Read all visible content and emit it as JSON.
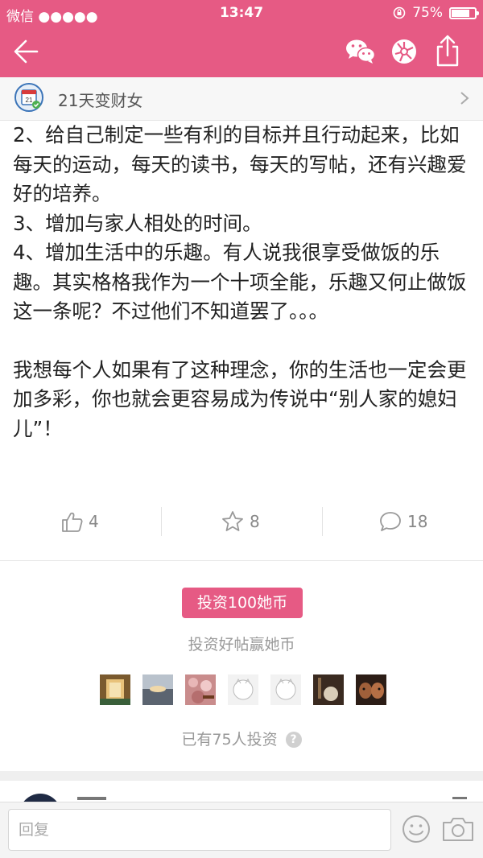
{
  "status_bar": {
    "carrier": "微信 ●●●●●",
    "time": "13:47",
    "battery": "75%"
  },
  "nav": {
    "back_icon": "arrow-left-icon",
    "wechat_icon": "wechat-icon",
    "moments_icon": "moments-icon",
    "share_icon": "share-icon"
  },
  "source": {
    "name": "21天变财女",
    "icon_text": "21"
  },
  "article": {
    "paragraphs": [
      "2、给自己制定一些有利的目标并且行动起来，比如每天的运动，每天的读书，每天的写帖，还有兴趣爱好的培养。",
      "3、增加与家人相处的时间。",
      "4、增加生活中的乐趣。有人说我很享受做饭的乐趣。其实格格我作为一个十项全能，乐趣又何止做饭这一条呢？不过他们不知道罢了。。。",
      "我想每个人如果有了这种理念，你的生活也一定会更加多彩，你也就会更容易成为传说中“别人家的媳妇儿”！"
    ]
  },
  "actions": {
    "likes": "4",
    "favorites": "8",
    "comments": "18"
  },
  "invest": {
    "button_label": "投资100她币",
    "tip": "投资好帖赢她币",
    "count_text": "已有75人投资",
    "help": "?"
  },
  "reply": {
    "placeholder": "回复"
  },
  "colors": {
    "brand": "#E65A84",
    "text": "#222222",
    "muted": "#999999"
  }
}
